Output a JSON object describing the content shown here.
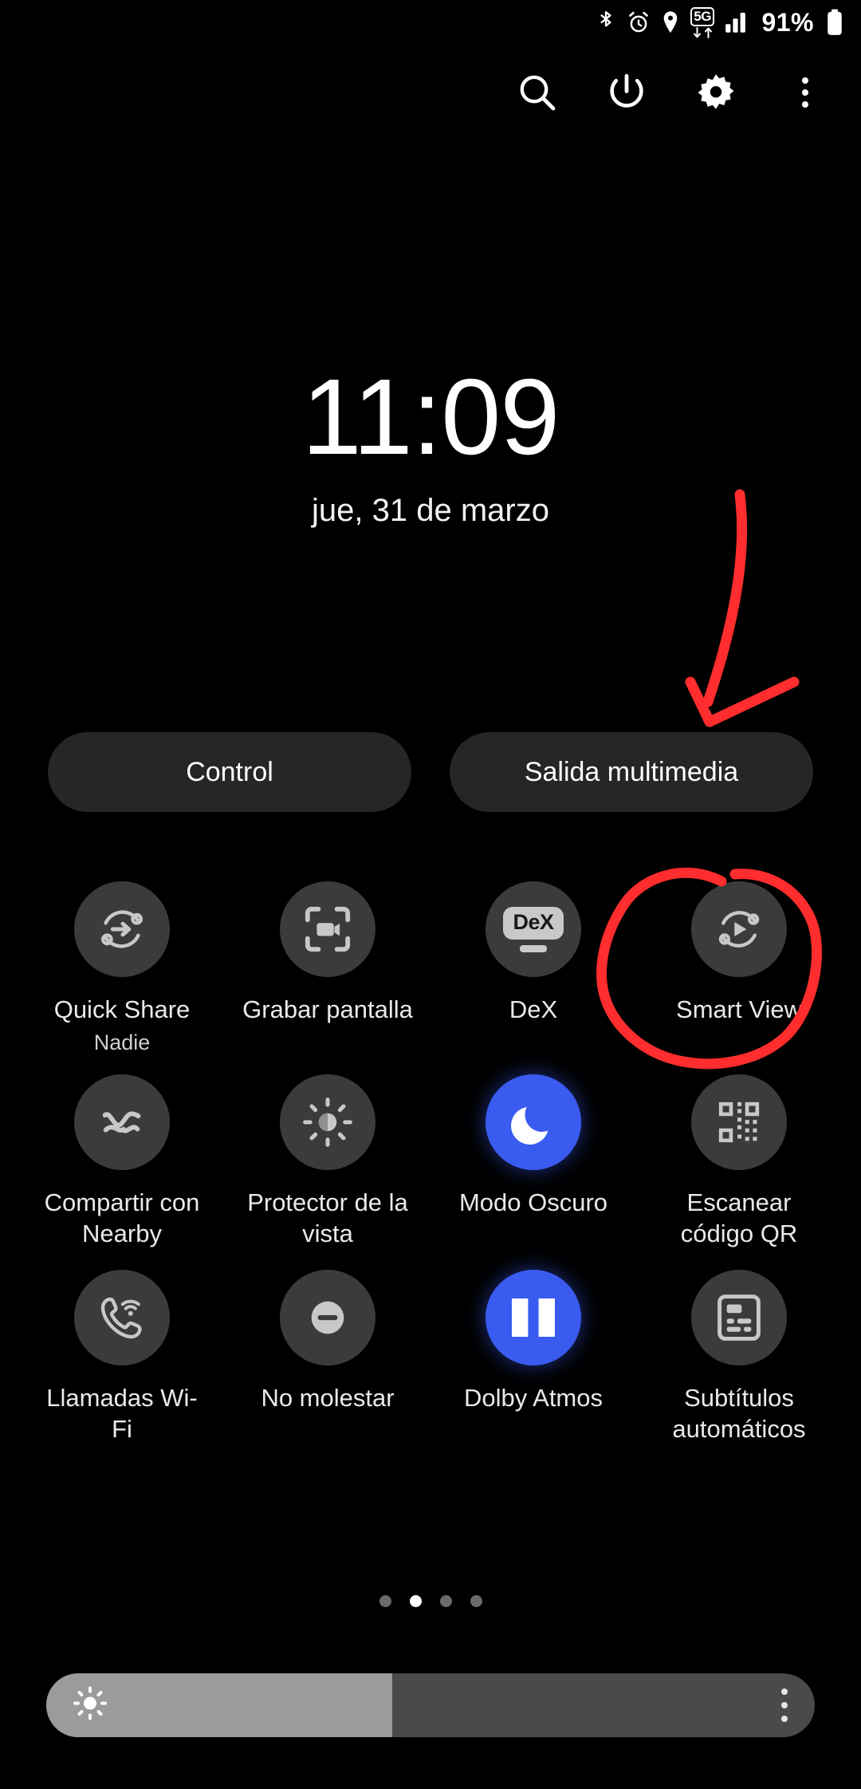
{
  "statusbar": {
    "icons": [
      "bluetooth-icon",
      "alarm-icon",
      "location-icon"
    ],
    "network_label": "5G",
    "signal": "signal-bars-icon",
    "battery_percent": "91%",
    "battery_icon": "battery-full-icon"
  },
  "toolbar": {
    "search_label": "search-icon",
    "power_label": "power-icon",
    "settings_label": "gear-icon",
    "more_label": "kebab-menu-icon"
  },
  "clock": {
    "time": "11:09",
    "date": "jue, 31 de marzo"
  },
  "pills": [
    {
      "label": "Control"
    },
    {
      "label": "Salida multimedia"
    }
  ],
  "tiles": [
    [
      {
        "label": "Quick Share",
        "sub": "Nadie",
        "icon": "quick-share-icon",
        "active": false
      },
      {
        "label": "Grabar pantalla",
        "sub": "",
        "icon": "screen-record-icon",
        "active": false
      },
      {
        "label": "DeX",
        "sub": "",
        "icon": "dex-icon",
        "active": false
      },
      {
        "label": "Smart View",
        "sub": "",
        "icon": "smart-view-icon",
        "active": false
      }
    ],
    [
      {
        "label": "Compartir con Nearby",
        "sub": "",
        "icon": "nearby-share-icon",
        "active": false
      },
      {
        "label": "Protector de la vista",
        "sub": "",
        "icon": "eye-comfort-icon",
        "active": false
      },
      {
        "label": "Modo Oscuro",
        "sub": "",
        "icon": "moon-icon",
        "active": true
      },
      {
        "label": "Escanear código QR",
        "sub": "",
        "icon": "qr-code-icon",
        "active": false
      }
    ],
    [
      {
        "label": "Llamadas Wi-Fi",
        "sub": "",
        "icon": "wifi-calling-icon",
        "active": false
      },
      {
        "label": "No molestar",
        "sub": "",
        "icon": "do-not-disturb-icon",
        "active": false
      },
      {
        "label": "Dolby Atmos",
        "sub": "",
        "icon": "dolby-icon",
        "active": true
      },
      {
        "label": "Subtítulos automáticos",
        "sub": "",
        "icon": "live-caption-icon",
        "active": false
      }
    ]
  ],
  "pager": {
    "count": 4,
    "active_index": 1
  },
  "brightness": {
    "value_percent": 45,
    "icon": "brightness-sun-icon",
    "more_icon": "kebab-menu-icon"
  },
  "annotations": {
    "arrow_color": "#ff2d2d",
    "circle_color": "#ff2d2d",
    "arrow_target": "Salida multimedia",
    "circle_target": "Smart View"
  },
  "colors": {
    "background": "#000000",
    "tile_off": "#3b3b3b",
    "tile_on": "#3a5bf0",
    "pill": "#262626",
    "slider_track": "#4a4a4a",
    "slider_fill": "#9b9b9b"
  }
}
